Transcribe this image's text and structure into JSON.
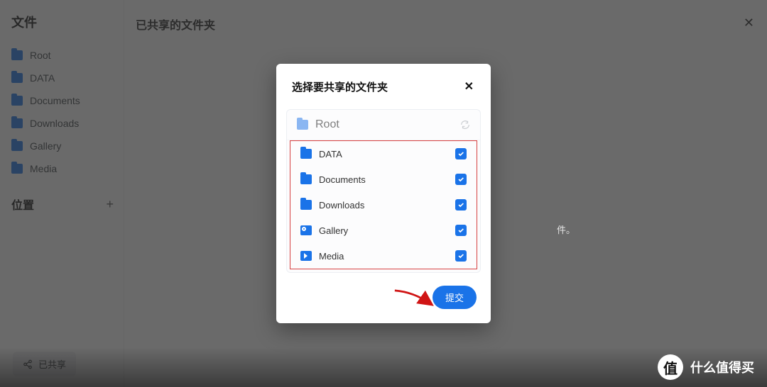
{
  "sidebar": {
    "title": "文件",
    "items": [
      {
        "label": "Root"
      },
      {
        "label": "DATA"
      },
      {
        "label": "Documents"
      },
      {
        "label": "Downloads"
      },
      {
        "label": "Gallery"
      },
      {
        "label": "Media"
      }
    ],
    "location_title": "位置",
    "share_label": "已共享"
  },
  "page": {
    "title": "已共享的文件夹",
    "hint_suffix": "件。"
  },
  "modal": {
    "title": "选择要共享的文件夹",
    "root_label": "Root",
    "folders": [
      {
        "label": "DATA",
        "icon": "folder",
        "checked": true
      },
      {
        "label": "Documents",
        "icon": "folder",
        "checked": true
      },
      {
        "label": "Downloads",
        "icon": "folder",
        "checked": true
      },
      {
        "label": "Gallery",
        "icon": "img",
        "checked": true
      },
      {
        "label": "Media",
        "icon": "media",
        "checked": true
      }
    ],
    "submit_label": "提交"
  },
  "watermark": {
    "badge_char": "值",
    "text": "什么值得买"
  }
}
